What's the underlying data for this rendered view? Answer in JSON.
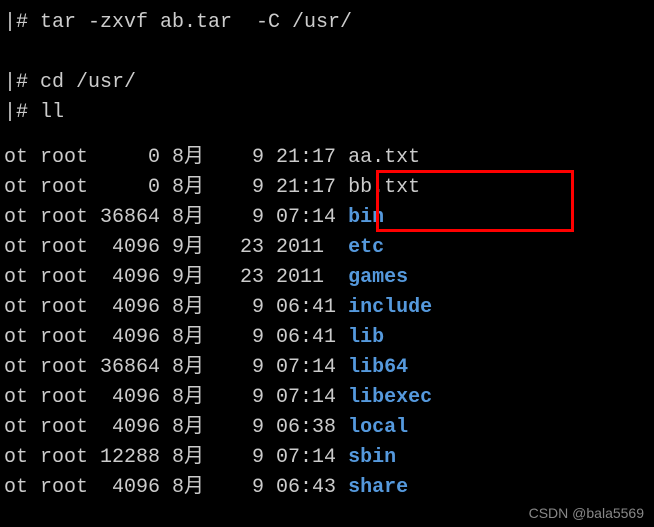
{
  "commands": {
    "tar": "|# tar -zxvf ab.tar  -C /usr/",
    "cd": "|# cd /usr/",
    "ll": "|# ll"
  },
  "listing": [
    {
      "perm": "ot root",
      "size": "    0",
      "month": "8月",
      "day": " 9",
      "time": "21:17",
      "name": "aa.txt",
      "type": "file"
    },
    {
      "perm": "ot root",
      "size": "    0",
      "month": "8月",
      "day": " 9",
      "time": "21:17",
      "name": "bb.txt",
      "type": "file"
    },
    {
      "perm": "ot root",
      "size": "36864",
      "month": "8月",
      "day": " 9",
      "time": "07:14",
      "name": "bin",
      "type": "dir"
    },
    {
      "perm": "ot root",
      "size": " 4096",
      "month": "9月",
      "day": "23",
      "time": "2011 ",
      "name": "etc",
      "type": "dir"
    },
    {
      "perm": "ot root",
      "size": " 4096",
      "month": "9月",
      "day": "23",
      "time": "2011 ",
      "name": "games",
      "type": "dir"
    },
    {
      "perm": "ot root",
      "size": " 4096",
      "month": "8月",
      "day": " 9",
      "time": "06:41",
      "name": "include",
      "type": "dir"
    },
    {
      "perm": "ot root",
      "size": " 4096",
      "month": "8月",
      "day": " 9",
      "time": "06:41",
      "name": "lib",
      "type": "dir"
    },
    {
      "perm": "ot root",
      "size": "36864",
      "month": "8月",
      "day": " 9",
      "time": "07:14",
      "name": "lib64",
      "type": "dir"
    },
    {
      "perm": "ot root",
      "size": " 4096",
      "month": "8月",
      "day": " 9",
      "time": "07:14",
      "name": "libexec",
      "type": "dir"
    },
    {
      "perm": "ot root",
      "size": " 4096",
      "month": "8月",
      "day": " 9",
      "time": "06:38",
      "name": "local",
      "type": "dir"
    },
    {
      "perm": "ot root",
      "size": "12288",
      "month": "8月",
      "day": " 9",
      "time": "07:14",
      "name": "sbin",
      "type": "dir"
    },
    {
      "perm": "ot root",
      "size": " 4096",
      "month": "8月",
      "day": " 9",
      "time": "06:43",
      "name": "share",
      "type": "dir"
    }
  ],
  "watermark": "CSDN @bala5569"
}
